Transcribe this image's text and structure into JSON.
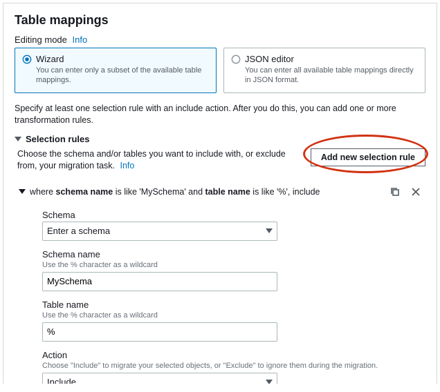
{
  "title": "Table mappings",
  "editingMode": {
    "label": "Editing mode",
    "infoLabel": "Info"
  },
  "modes": {
    "wizard": {
      "title": "Wizard",
      "desc": "You can enter only a subset of the available table mappings.",
      "selected": true
    },
    "json": {
      "title": "JSON editor",
      "desc": "You can enter all available table mappings directly in JSON format.",
      "selected": false
    }
  },
  "helpText": "Specify at least one selection rule with an include action. After you do this, you can add one or more transformation rules.",
  "selectionRules": {
    "header": "Selection rules",
    "desc": "Choose the schema and/or tables you want to include with, or exclude from, your migration task.",
    "infoLabel": "Info",
    "addButton": "Add new selection rule",
    "rule": {
      "prefix": "where ",
      "schemaLabel": "schema name",
      "mid1": " is like 'MySchema' and ",
      "tableLabel": "table name",
      "mid2": " is like '%', include"
    }
  },
  "form": {
    "schema": {
      "label": "Schema",
      "value": "Enter a schema"
    },
    "schemaName": {
      "label": "Schema name",
      "hint": "Use the % character as a wildcard",
      "value": "MySchema"
    },
    "tableName": {
      "label": "Table name",
      "hint": "Use the % character as a wildcard",
      "value": "%"
    },
    "action": {
      "label": "Action",
      "hint": "Choose \"Include\" to migrate your selected objects, or \"Exclude\" to ignore them during the migration.",
      "value": "Include"
    }
  }
}
